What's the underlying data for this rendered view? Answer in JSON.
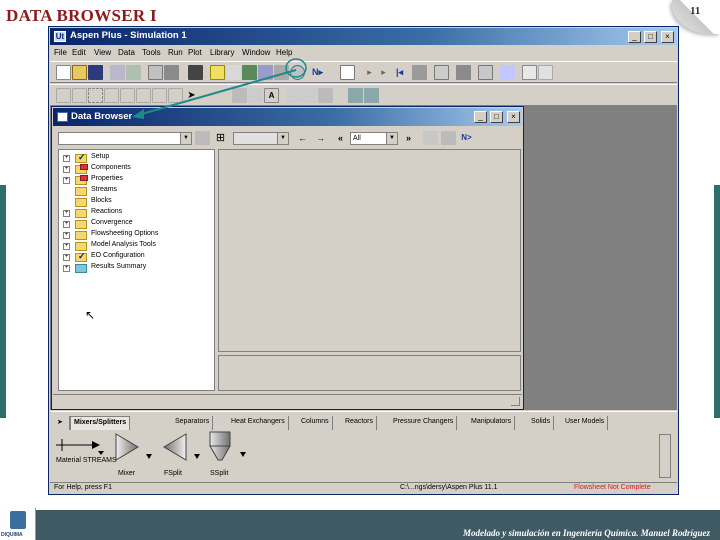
{
  "slide": {
    "title": "DATA BROWSER I",
    "page_number": "11",
    "footer": "Modelado y simulación en Ingeniería Química. Manuel Rodríguez",
    "logo_text": "DIQUIMA"
  },
  "app": {
    "title": "Aspen Plus - Simulation 1",
    "icon_text": "Ut",
    "menu": [
      "File",
      "Edit",
      "View",
      "Data",
      "Tools",
      "Run",
      "Plot",
      "Library",
      "Window",
      "Help"
    ]
  },
  "data_browser": {
    "title": "Data Browser",
    "filter_value": "All",
    "next_label": "N>",
    "tree": [
      {
        "label": "Setup",
        "status": "check",
        "expand": true
      },
      {
        "label": "Components",
        "status": "red",
        "expand": true
      },
      {
        "label": "Properties",
        "status": "red",
        "expand": true
      },
      {
        "label": "Streams",
        "status": "none",
        "expand": false
      },
      {
        "label": "Blocks",
        "status": "none",
        "expand": false
      },
      {
        "label": "Reactions",
        "status": "none",
        "expand": true
      },
      {
        "label": "Convergence",
        "status": "none",
        "expand": true
      },
      {
        "label": "Flowsheeting Options",
        "status": "none",
        "expand": true
      },
      {
        "label": "Model Analysis Tools",
        "status": "none",
        "expand": true
      },
      {
        "label": "EO Configuration",
        "status": "check",
        "expand": true
      },
      {
        "label": "Results Summary",
        "status": "none",
        "expand": true
      }
    ]
  },
  "palette": {
    "tabs": [
      "Mixers/Splitters",
      "Separators",
      "Heat Exchangers",
      "Columns",
      "Reactors",
      "Pressure Changers",
      "Manipulators",
      "Solids",
      "User Models"
    ],
    "models": [
      "Material STREAMS",
      "Mixer",
      "FSplit",
      "SSplit"
    ]
  },
  "status": {
    "left": "For Help, press F1",
    "path": "C:\\...ngs\\dersy\\Aspen Plus 11.1",
    "right": "Flowsheet Not Complete",
    "right_color": "#d02020"
  }
}
